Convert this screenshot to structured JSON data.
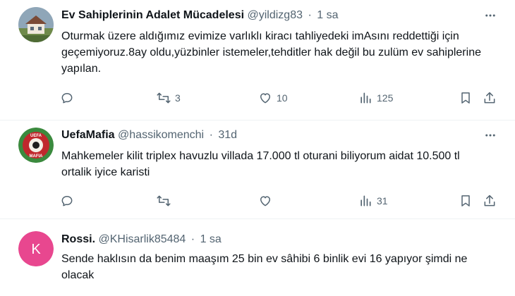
{
  "tweets": [
    {
      "name": "Ev Sahiplerinin Adalet Mücadelesi",
      "handle": "@yildizg83",
      "separator": "·",
      "time": "1 sa",
      "text": "Oturmak üzere aldığımız evimize varlıklı kiracı tahliyedeki imAsını reddettiği için geçemiyoruz.8ay oldu,yüzbinler istemeler,tehditler hak değil bu zulüm ev sahiplerine yapılan.",
      "replies": "",
      "retweets": "3",
      "likes": "10",
      "views": "125"
    },
    {
      "name": "UefaMafia",
      "handle": "@hassikomenchi",
      "separator": "·",
      "time": "31d",
      "text": "Mahkemeler kilit triplex havuzlu villada 17.000 tl oturani biliyorum aidat 10.500 tl ortalik iyice karisti",
      "replies": "",
      "retweets": "",
      "likes": "",
      "views": "31",
      "avatar_text_top": "UEFA",
      "avatar_text_bottom": "MAFIA"
    },
    {
      "name": "Rossi.",
      "handle": "@KHisarlik85484",
      "separator": "·",
      "time": "1 sa",
      "text": "Sende haklısın da benim maaşım 25 bin ev sâhibi 6 binlik evi 16 yapıyor şimdi ne olacak",
      "avatar_letter": "K"
    }
  ],
  "colors": {
    "text": "#0f1419",
    "muted": "#536471",
    "divider": "#eff3f4",
    "avatar_k": "#e8478f"
  }
}
